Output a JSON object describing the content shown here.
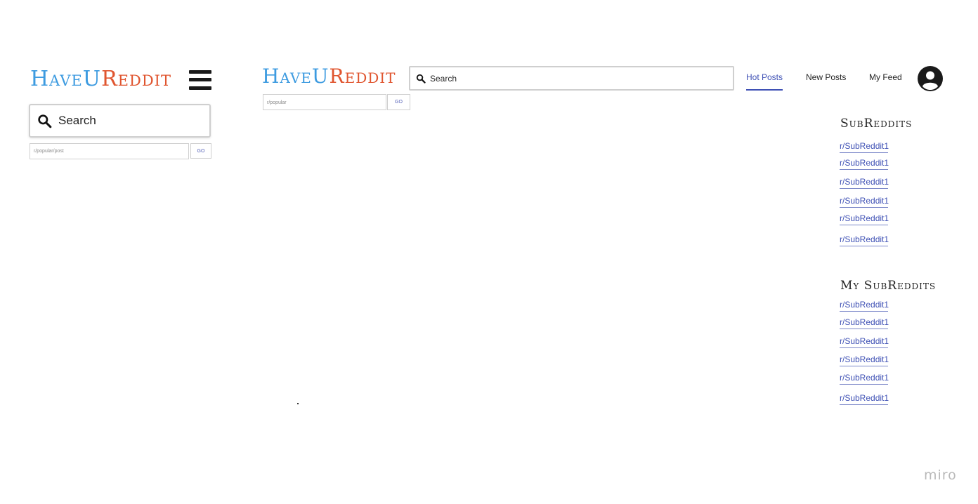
{
  "brand": {
    "part1": "HaveU",
    "part2": "Reddit"
  },
  "mobile": {
    "search_label": "Search",
    "path_placeholder": "r/popular/post",
    "go_label": "GO"
  },
  "desktop": {
    "search_label": "Search",
    "path_placeholder": "r/popular",
    "go_label": "GO",
    "nav": {
      "hot": "Hot Posts",
      "new": "New Posts",
      "feed": "My Feed"
    },
    "active_nav": "Hot Posts"
  },
  "sidebar": {
    "subreddits_title": "SubReddits",
    "subreddits": [
      "r/SubReddit1",
      "r/SubReddit1",
      "r/SubReddit1",
      "r/SubReddit1",
      "r/SubReddit1",
      "r/SubReddit1"
    ],
    "my_subreddits_title": "My SubReddits",
    "my_subreddits": [
      "r/SubReddit1",
      "r/SubReddit1",
      "r/SubReddit1",
      "r/SubReddit1",
      "r/SubReddit1",
      "r/SubReddit1"
    ]
  },
  "watermark": "miro",
  "colors": {
    "brand_blue": "#3d9be0",
    "brand_red": "#e0552f",
    "accent": "#3f51b5"
  },
  "icons": {
    "search": "search-icon",
    "menu": "hamburger-menu-icon",
    "account": "account-circle-icon"
  }
}
